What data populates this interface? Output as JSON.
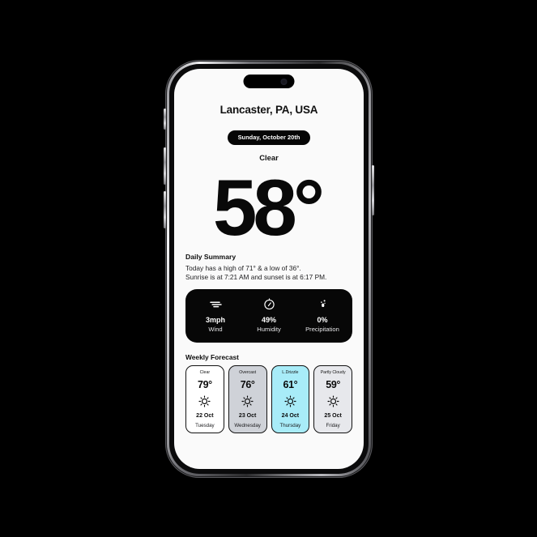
{
  "device": {
    "frame_name": "smartphone-mockup",
    "notch": "dynamic-island",
    "screen_bg": "#fafafa",
    "buttons": [
      "silent-switch",
      "volume-up",
      "volume-down",
      "power"
    ]
  },
  "app": {
    "location": "Lancaster, PA, USA",
    "date_pill": "Sunday, October 20th",
    "condition": "Clear",
    "temperature": "58",
    "temperature_unit": "°",
    "summary": {
      "title": "Daily Summary",
      "line1": "Today has a high of 71° & a low of 36°.",
      "line2": "Sunrise is at 7:21 AM and sunset is at 6:17 PM."
    },
    "stats": {
      "card_bg": "#070707",
      "items": [
        {
          "icon": "wind-icon",
          "value": "3mph",
          "label": "Wind"
        },
        {
          "icon": "humidity-gauge-icon",
          "value": "49%",
          "label": "Humidity"
        },
        {
          "icon": "precipitation-icon",
          "value": "0%",
          "label": "Precipitation"
        }
      ]
    },
    "weekly": {
      "title": "Weekly Forecast",
      "cards": [
        {
          "condition": "Clear",
          "temp": "79°",
          "icon": "sun-icon",
          "date": "22 Oct",
          "day": "Tuesday",
          "bg": "#ffffff"
        },
        {
          "condition": "Overcast",
          "temp": "76°",
          "icon": "sun-icon",
          "date": "23 Oct",
          "day": "Wednesday",
          "bg": "#cfd2d8"
        },
        {
          "condition": "L.Drizzle",
          "temp": "61°",
          "icon": "sun-icon",
          "date": "24 Oct",
          "day": "Thursday",
          "bg": "#a8ecf8"
        },
        {
          "condition": "Partly Cloudy",
          "temp": "59°",
          "icon": "sun-icon",
          "date": "25 Oct",
          "day": "Friday",
          "bg": "#e7e8ec"
        }
      ]
    }
  }
}
